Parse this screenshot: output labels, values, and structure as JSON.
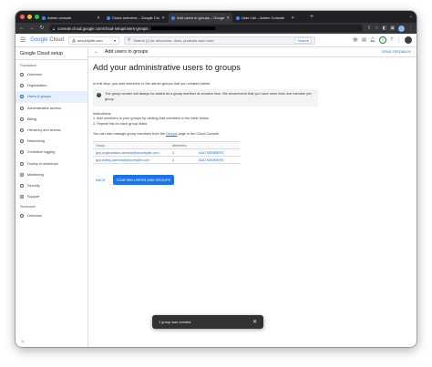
{
  "browser": {
    "tabs": [
      {
        "title": "Admin console",
        "color": "#4285f4"
      },
      {
        "title": "Cloud overview – Google Clo...",
        "color": "#4285f4"
      },
      {
        "title": "Add users to groups – Google...",
        "color": "#4285f4"
      },
      {
        "title": "User List – Admin Console",
        "color": "#4285f4"
      }
    ],
    "url": "console.cloud.google.com/cloud-setup/users-groups"
  },
  "header": {
    "logo_brand": "Google",
    "logo_product": " Cloud",
    "project": "securitytile.com",
    "search_placeholder": "Search (/) for resources, docs, products and more",
    "search_button": "Search"
  },
  "sidebar": {
    "title": "Google Cloud setup",
    "sections": [
      {
        "label": "Foundation",
        "items": [
          {
            "label": "Overview",
            "active": false
          },
          {
            "label": "Organization",
            "active": false
          },
          {
            "label": "Users & groups",
            "active": true
          },
          {
            "label": "Administrative access",
            "active": false
          },
          {
            "label": "Billing",
            "active": false
          },
          {
            "label": "Hierarchy and access",
            "active": false
          },
          {
            "label": "Networking",
            "active": false
          },
          {
            "label": "Centralize logging",
            "active": false
          },
          {
            "label": "Deploy or download",
            "active": false
          },
          {
            "label": "Monitoring",
            "active": false
          },
          {
            "label": "Security",
            "active": false
          },
          {
            "label": "Support",
            "active": false
          }
        ]
      },
      {
        "label": "Workloads",
        "items": [
          {
            "label": "Overview",
            "active": false
          }
        ]
      }
    ],
    "collapse": "<|"
  },
  "page": {
    "title": "Add users to groups",
    "feedback": "SEND FEEDBACK",
    "heading": "Add your administrative users to groups",
    "intro": "In this step, you add members to the admin groups that you created earlier.",
    "note": "The group creator will always be added as a group member at creation time. We recommend that you have more than one member per group.",
    "instructions_label": "Instructions:",
    "instructions": [
      "1. Add members to your groups by clicking Add members in the table below.",
      "2. Repeat this for each group listed."
    ],
    "manage_prefix": "You can also manage group members from the ",
    "manage_link": "Groups",
    "manage_suffix": " page in the Cloud Console.",
    "table": {
      "headers": [
        "Group",
        "Members",
        ""
      ],
      "rows": [
        {
          "group": "gcp-organization-admins@securitytile.com",
          "members": "1",
          "action": "ADD MEMBERS"
        },
        {
          "group": "gcp-billing-admins@securitytile.com",
          "members": "1",
          "action": "ADD MEMBERS"
        }
      ]
    },
    "back_button": "BACK",
    "confirm_button": "CONFIRM USERS AND GROUPS"
  },
  "snackbar": {
    "text": "1 group was created.",
    "close": "✕"
  }
}
